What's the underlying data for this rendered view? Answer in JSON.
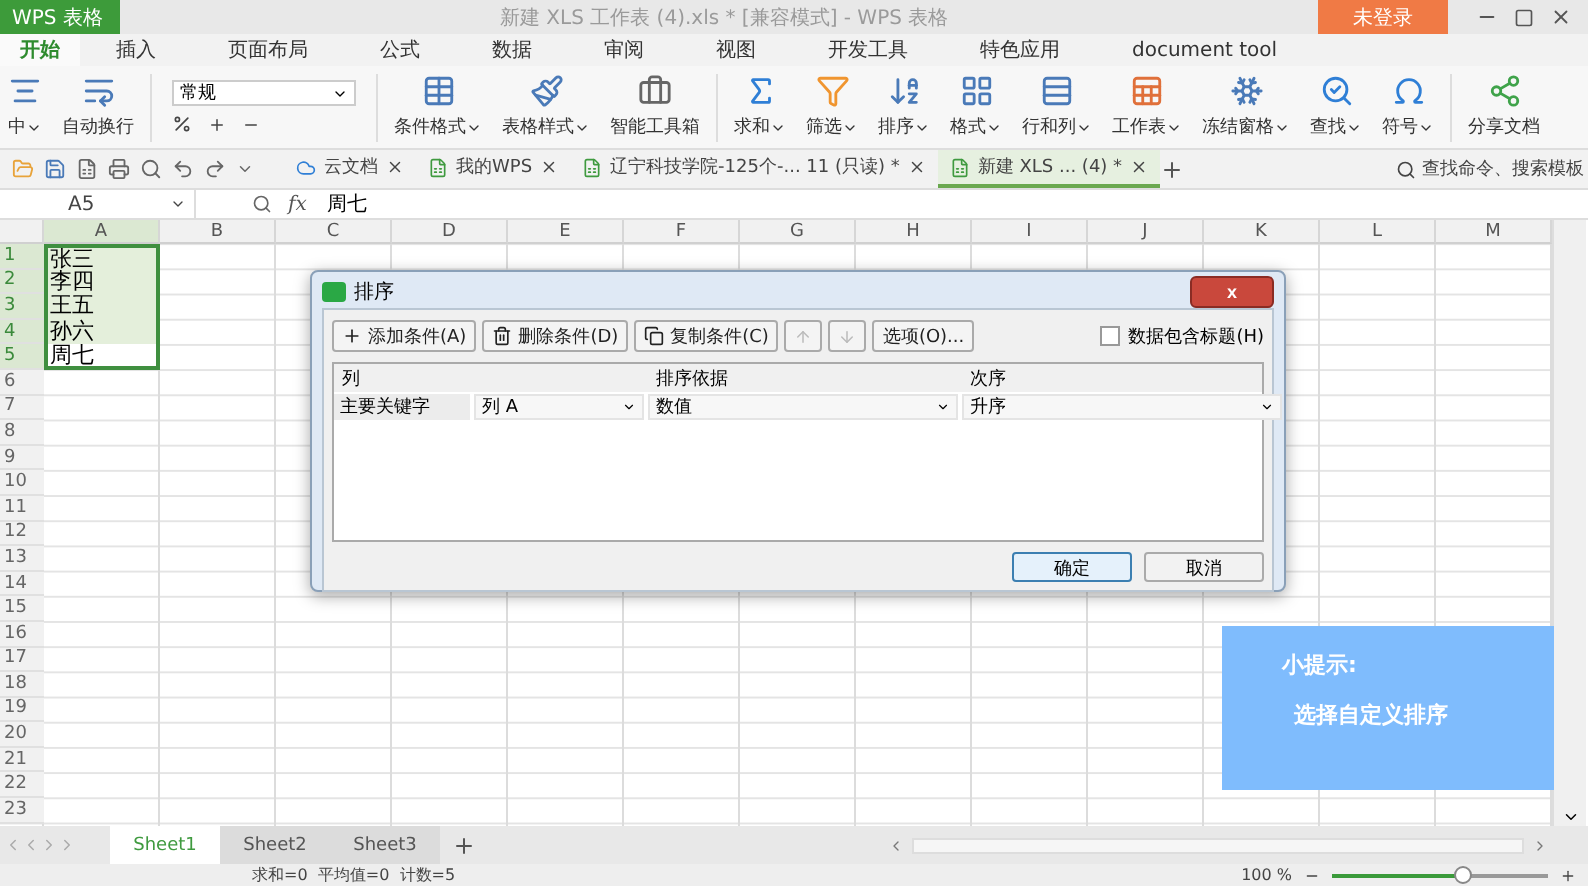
{
  "title_bar": {
    "app_label": "WPS 表格",
    "title": "新建 XLS 工作表 (4).xls * [兼容模式] - WPS 表格",
    "login_button": "未登录"
  },
  "menu_tabs": [
    {
      "label": "开始",
      "selected": true
    },
    {
      "label": "插入",
      "selected": false
    },
    {
      "label": "页面布局",
      "selected": false
    },
    {
      "label": "公式",
      "selected": false
    },
    {
      "label": "数据",
      "selected": false
    },
    {
      "label": "审阅",
      "selected": false
    },
    {
      "label": "视图",
      "selected": false
    },
    {
      "label": "开发工具",
      "selected": false
    },
    {
      "label": "特色应用",
      "selected": false
    },
    {
      "label": "document tool",
      "selected": false
    }
  ],
  "ribbon": {
    "number_format": "常规",
    "tools": [
      {
        "label": "中",
        "menu": true
      },
      {
        "label": "自动换行",
        "menu": false
      },
      {
        "label": "条件格式",
        "menu": true
      },
      {
        "label": "表格样式",
        "menu": true
      },
      {
        "label": "智能工具箱",
        "menu": false
      },
      {
        "label": "求和",
        "menu": true
      },
      {
        "label": "筛选",
        "menu": true
      },
      {
        "label": "排序",
        "menu": true
      },
      {
        "label": "格式",
        "menu": true
      },
      {
        "label": "行和列",
        "menu": true
      },
      {
        "label": "工作表",
        "menu": true
      },
      {
        "label": "冻结窗格",
        "menu": true
      },
      {
        "label": "查找",
        "menu": true
      },
      {
        "label": "符号",
        "menu": true
      },
      {
        "label": "分享文档",
        "menu": false
      }
    ]
  },
  "doc_tabs": [
    {
      "label": "云文档",
      "selected": false
    },
    {
      "label": "我的WPS",
      "selected": false
    },
    {
      "label": "辽宁科技学院-125个-... 11 (只读) *",
      "selected": false
    },
    {
      "label": "新建 XLS ... (4) *",
      "selected": true
    }
  ],
  "search": {
    "placeholder": "查找命令、搜索模板"
  },
  "formula_bar": {
    "name_box": "A5",
    "fx": "fx",
    "value": "周七"
  },
  "columns": [
    "A",
    "B",
    "C",
    "D",
    "E",
    "F",
    "G",
    "H",
    "I",
    "J",
    "K",
    "L",
    "M"
  ],
  "rows": [
    "1",
    "2",
    "3",
    "4",
    "5",
    "6",
    "7",
    "8",
    "9",
    "10",
    "11",
    "12",
    "13",
    "14",
    "15",
    "16",
    "17",
    "18",
    "19",
    "20",
    "21",
    "22",
    "23"
  ],
  "cells": [
    {
      "text": "张三",
      "highlighted": true
    },
    {
      "text": "李四",
      "highlighted": true
    },
    {
      "text": "王五",
      "highlighted": true
    },
    {
      "text": "孙六",
      "highlighted": true
    },
    {
      "text": "周七",
      "highlighted": false
    }
  ],
  "dialog": {
    "title": "排序",
    "close": "x",
    "toolbar": [
      "添加条件(A)",
      "删除条件(D)",
      "复制条件(C)"
    ],
    "options_button": "选项(O)...",
    "header_checkbox": {
      "label": "数据包含标题(H)",
      "checked": false
    },
    "headers": [
      "列",
      "排序依据",
      "次序"
    ],
    "rows": [
      {
        "key": "主要关键字",
        "column": "列 A",
        "basis": "数值",
        "order": "升序"
      }
    ],
    "ok": "确定",
    "cancel": "取消"
  },
  "tip": {
    "title": "小提示:",
    "text": "选择自定义排序"
  },
  "sheets": [
    {
      "label": "Sheet1",
      "selected": true
    },
    {
      "label": "Sheet2",
      "selected": false
    },
    {
      "label": "Sheet3",
      "selected": false
    }
  ],
  "status": {
    "summary": "求和=0  平均值=0  计数=5",
    "zoom": "100 %",
    "zoom_slider": {
      "level": 0.6
    }
  }
}
